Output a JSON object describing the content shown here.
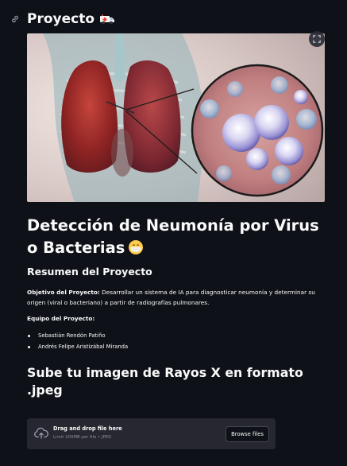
{
  "header": {
    "title": "Proyecto",
    "title_emoji": "ambulance-icon"
  },
  "hero_image": {
    "description_icon": "lungs-bacteria-illustration",
    "fullscreen_icon": "expand-icon"
  },
  "main": {
    "heading": "Detección de Neumonía por Virus o Bacterias",
    "heading_emoji": "face-with-mask-icon",
    "summary_title": "Resumen del Proyecto",
    "objective_label": "Objetivo del Proyecto:",
    "objective_text": " Desarrollar un sistema de IA para diagnosticar neumonía y determinar su origen (viral o bacteriano) a partir de radiografías pulmonares.",
    "team_label": "Equipo del Proyecto:",
    "team": [
      "Sebastián Rendón Patiño",
      "Andrés Felipe Aristizábal Miranda"
    ],
    "upload_heading": "Sube tu imagen de Rayos X en formato .jpeg"
  },
  "uploader": {
    "drop_title": "Drag and drop file here",
    "limit_text": "Limit 200MB per file • JPEG",
    "browse_label": "Browse files",
    "icon": "cloud-upload-icon"
  },
  "colors": {
    "background": "#0e1117",
    "text": "#fafafa",
    "uploader_bg": "#262730",
    "muted": "#8b8f98",
    "accent_red": "#e8442c"
  }
}
